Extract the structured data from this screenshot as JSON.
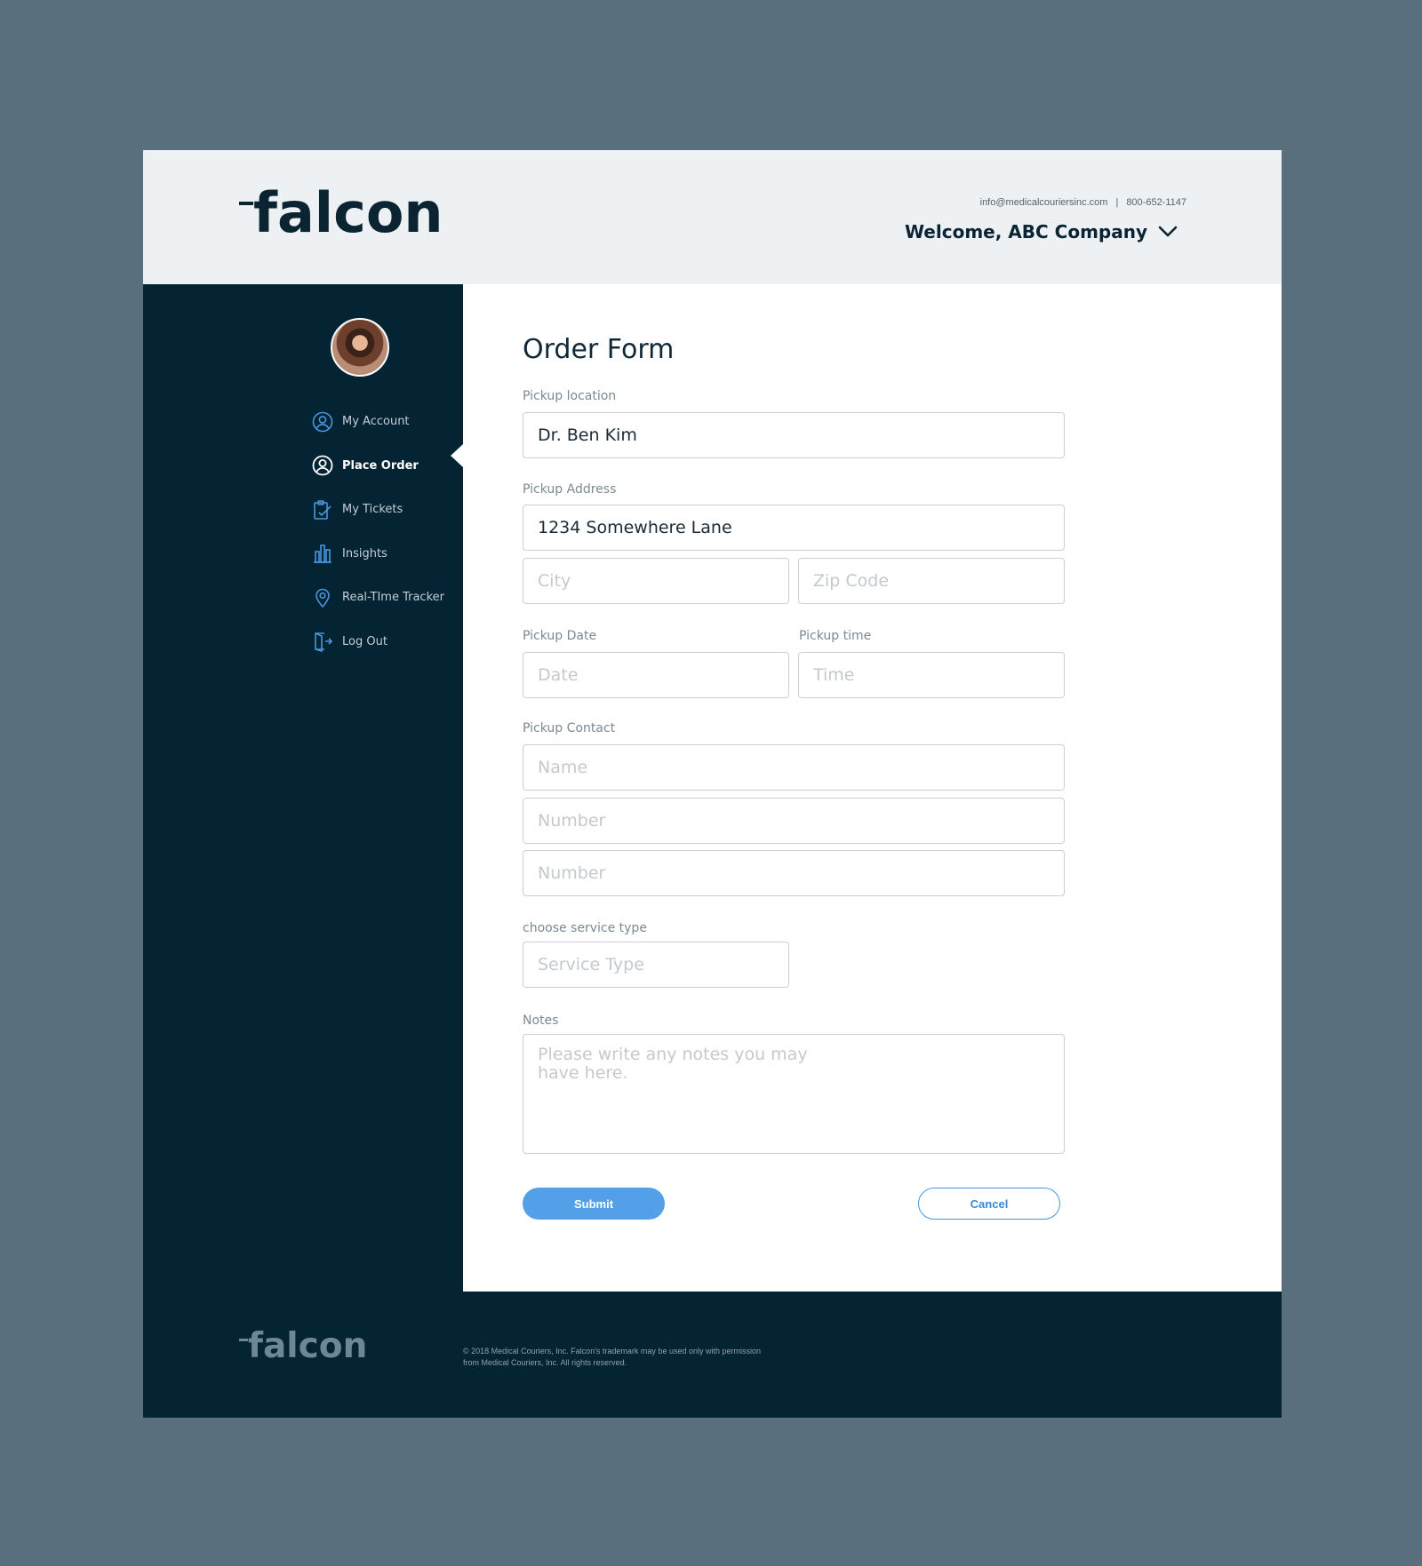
{
  "header": {
    "logo_text": "falcon",
    "email": "info@medicalcouriersinc.com",
    "separator": "|",
    "phone": "800-652-1147",
    "welcome": "Welcome, ABC Company"
  },
  "sidebar": {
    "items": [
      {
        "label": "My Account",
        "icon": "user-circle-icon",
        "active": false
      },
      {
        "label": "Place Order",
        "icon": "user-circle-icon",
        "active": true
      },
      {
        "label": "My Tickets",
        "icon": "clipboard-check-icon",
        "active": false
      },
      {
        "label": "Insights",
        "icon": "bar-chart-icon",
        "active": false
      },
      {
        "label": "Real-TIme Tracker",
        "icon": "map-pin-icon",
        "active": false
      },
      {
        "label": "Log Out",
        "icon": "logout-door-icon",
        "active": false
      }
    ]
  },
  "form": {
    "title": "Order Form",
    "pickup_location": {
      "label": "Pickup location",
      "value": "Dr. Ben Kim"
    },
    "pickup_address": {
      "label": "Pickup Address",
      "value": "1234 Somewhere Lane"
    },
    "city": {
      "placeholder": "City"
    },
    "zip": {
      "placeholder": "Zip Code"
    },
    "pickup_date": {
      "label": "Pickup Date",
      "placeholder": "Date"
    },
    "pickup_time": {
      "label": "Pickup time",
      "placeholder": "Time"
    },
    "pickup_contact": {
      "label": "Pickup Contact",
      "name_placeholder": "Name",
      "number1_placeholder": "Number",
      "number2_placeholder": "Number"
    },
    "service": {
      "label": "choose service type",
      "placeholder": "Service Type"
    },
    "notes": {
      "label": "Notes",
      "placeholder": "Please write any notes you may\nhave here."
    },
    "submit_label": "Submit",
    "cancel_label": "Cancel"
  },
  "footer": {
    "logo_text": "falcon",
    "legal": "© 2018 Medical Couriers, Inc. Falcon's trademark may be used only with permission from Medical Couriers, Inc. All rights reserved."
  },
  "colors": {
    "background": "#5a6f7e",
    "header_bg": "#eef1f3",
    "sidebar_bg": "#042333",
    "accent": "#53a0e8",
    "nav_icon": "#4a96de"
  }
}
